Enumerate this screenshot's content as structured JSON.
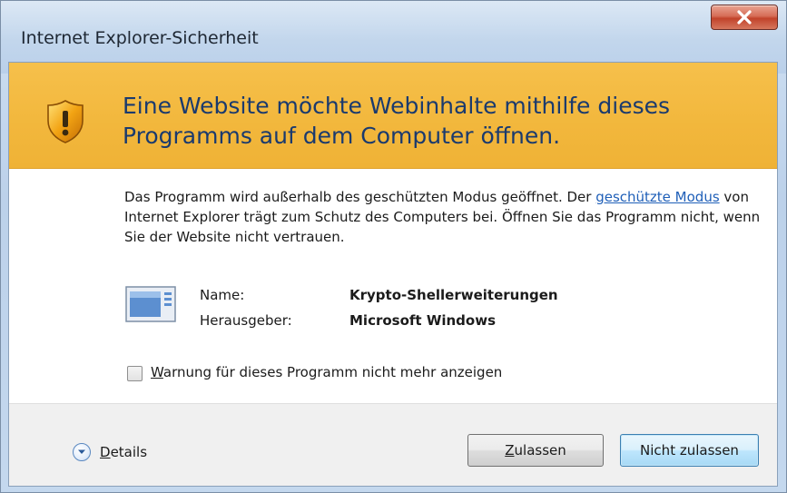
{
  "window": {
    "title": "Internet Explorer-Sicherheit"
  },
  "banner": {
    "icon": "shield-warning-icon",
    "heading_line1": "Eine Website möchte Webinhalte mithilfe dieses",
    "heading_line2": "Programms auf dem Computer öffnen."
  },
  "description": {
    "text_before_link": "Das Programm wird außerhalb des geschützten Modus geöffnet. Der ",
    "link_text": "geschützte Modus",
    "text_after_link": " von Internet Explorer trägt zum Schutz des Computers bei. Öffnen Sie das Programm nicht, wenn Sie der Website nicht vertrauen."
  },
  "program": {
    "icon": "program-window-icon",
    "name_label": "Name:",
    "name_value": "Krypto-Shellerweiterungen",
    "publisher_label": "Herausgeber:",
    "publisher_value": "Microsoft Windows"
  },
  "checkbox": {
    "checked": false,
    "label_mnemonic": "W",
    "label_rest": "arnung für dieses Programm nicht mehr anzeigen"
  },
  "footer": {
    "details_icon": "chevron-down-circle-icon",
    "details_mnemonic": "D",
    "details_rest": "etails",
    "allow_mnemonic": "Z",
    "allow_rest": "ulassen",
    "deny_label": "Nicht zulassen"
  },
  "colors": {
    "banner": "#f2b73c",
    "heading_text": "#1a3a6e",
    "link": "#1f5fb8",
    "close_button": "#c1432b"
  }
}
